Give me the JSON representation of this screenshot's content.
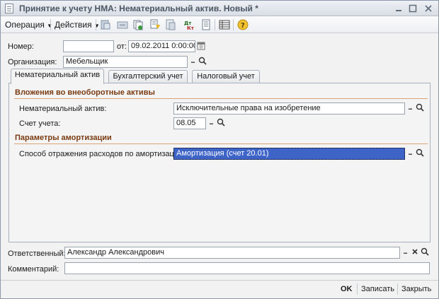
{
  "window": {
    "title": "Принятие к учету НМА: Нематериальный актив. Новый *",
    "minimize_icon": "minimize-icon",
    "maximize_icon": "maximize-icon",
    "close_icon": "close-icon"
  },
  "toolbar": {
    "operation_label": "Операция",
    "actions_label": "Действия",
    "icons": [
      "post-document-icon",
      "unpost-document-icon",
      "copy-document-icon",
      "structure-icon",
      "movements-icon",
      "dt-kt-icon",
      "report-icon",
      "list-icon",
      "help-icon"
    ]
  },
  "header": {
    "number_label": "Номер:",
    "number_value": "",
    "date_label": "от:",
    "date_value": "09.02.2011  0:00:00",
    "organization_label": "Организация:",
    "organization_value": "Мебельщик"
  },
  "tabs": [
    {
      "label": "Нематериальный актив",
      "active": true
    },
    {
      "label": "Бухгалтерский учет",
      "active": false
    },
    {
      "label": "Налоговый учет",
      "active": false
    }
  ],
  "sections": {
    "investments_title": "Вложения во внеоборотные активы",
    "intangible_label": "Нематериальный актив:",
    "intangible_value": "Исключительные права на изобретение",
    "account_label": "Счет учета:",
    "account_value": "08.05",
    "amortization_title": "Параметры амортизации",
    "expense_method_label": "Способ отражения расходов по амортизации:",
    "expense_method_value": "Амортизация (счет 20.01)"
  },
  "footer": {
    "responsible_label": "Ответственный:",
    "responsible_value": "Александр Александрович",
    "comment_label": "Комментарий:",
    "comment_value": ""
  },
  "buttons": {
    "ok_label": "OK",
    "save_label": "Записать",
    "close_label": "Закрыть"
  },
  "colors": {
    "section_title": "#7a3b12",
    "selection": "#3e64c8"
  }
}
